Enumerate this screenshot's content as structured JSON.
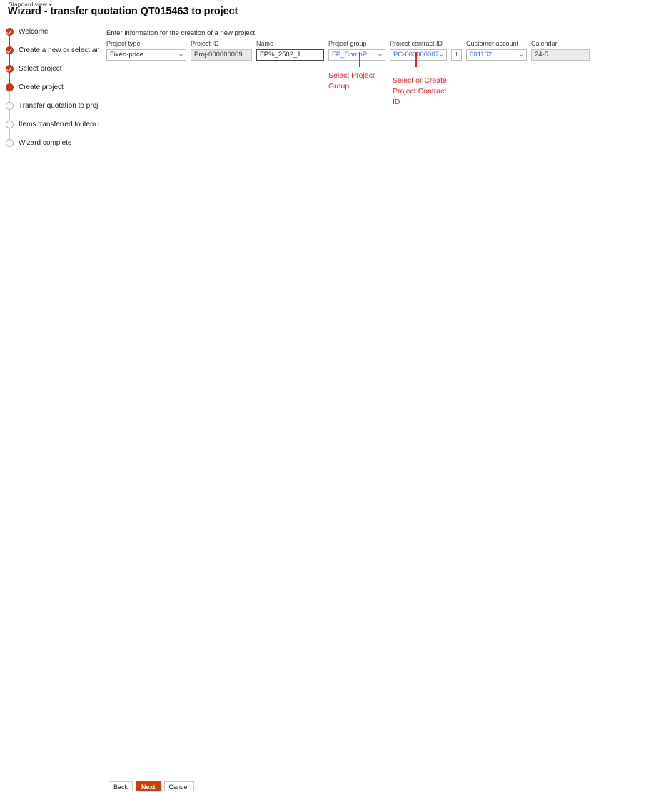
{
  "header": {
    "view_selector": "Standard view",
    "view_chevron_icon": "chevron-down-icon",
    "title": "Wizard - transfer quotation QT015463 to project"
  },
  "steps": [
    {
      "label": "Welcome",
      "state": "done"
    },
    {
      "label": "Create a new or select an exi...",
      "state": "done"
    },
    {
      "label": "Select project",
      "state": "done"
    },
    {
      "label": "Create project",
      "state": "current"
    },
    {
      "label": "Transfer quotation to project ...",
      "state": "pending"
    },
    {
      "label": "Items transferred to item req...",
      "state": "pending"
    },
    {
      "label": "Wizard complete",
      "state": "pending"
    }
  ],
  "form": {
    "instruction": "Enter information for the creation of a new project.",
    "fields": [
      {
        "label": "Project type",
        "value": "Fixed-price",
        "style": "plain",
        "dropdown": true,
        "name": "project-type"
      },
      {
        "label": "Project ID",
        "value": "Proj-000000009",
        "style": "shaded",
        "dropdown": false,
        "name": "project-id"
      },
      {
        "label": "Name",
        "value": "FP%_2502_1",
        "style": "focused",
        "dropdown": false,
        "name": "project-name"
      },
      {
        "label": "Project group",
        "value": "FP_CompP",
        "style": "link",
        "dropdown": true,
        "name": "project-group"
      },
      {
        "label": "Project contract ID",
        "value": "PC-000000007",
        "style": "link",
        "dropdown": true,
        "name": "project-contract-id"
      },
      {
        "label": "Customer account",
        "value": "001162",
        "style": "link",
        "dropdown": true,
        "name": "customer-account"
      },
      {
        "label": "Calendar",
        "value": "24-5",
        "style": "lightshade",
        "dropdown": false,
        "name": "calendar"
      }
    ],
    "add_contract_button": "+"
  },
  "annotations": [
    {
      "text": "Select Project\nGroup",
      "name": "annotation-project-group"
    },
    {
      "text": "Select or Create\nProject Contract\nID",
      "name": "annotation-project-contract"
    }
  ],
  "footer": {
    "back_label": "Back",
    "next_label": "Next",
    "cancel_label": "Cancel"
  },
  "colors": {
    "accent": "#d83b01",
    "step_active": "#c8371d",
    "annotation": "#ee2222",
    "link": "#3a6fd8"
  }
}
